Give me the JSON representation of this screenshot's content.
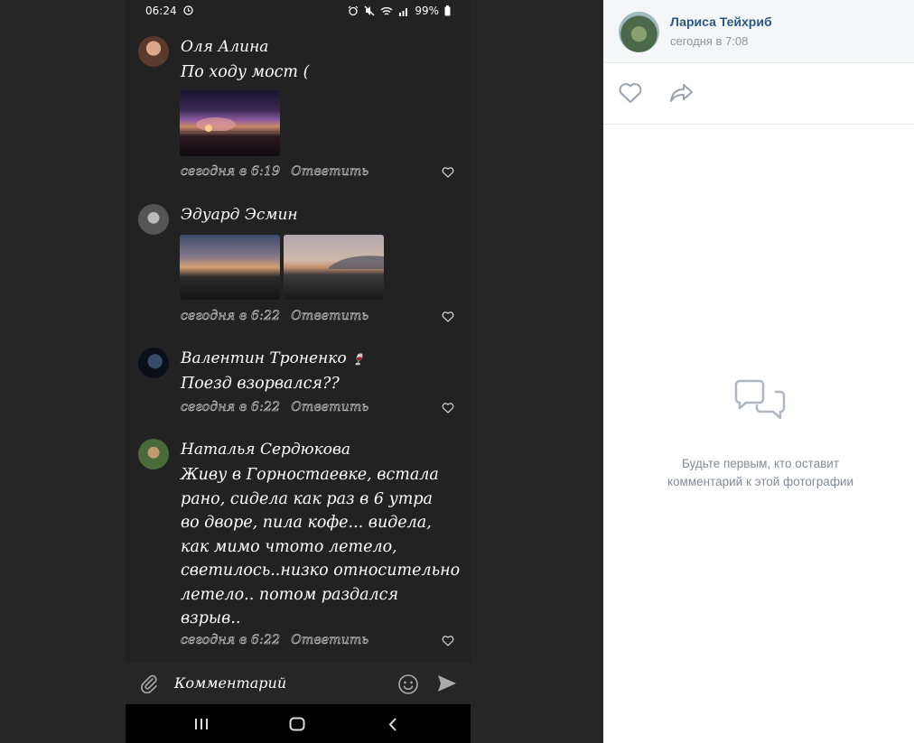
{
  "status_bar": {
    "time": "06:24",
    "battery": "99%"
  },
  "comments": [
    {
      "author": "Оля Алина",
      "text": "По ходу мост (",
      "time": "сегодня в 6:19",
      "reply": "Ответить"
    },
    {
      "author": "Эдуард Эсмин",
      "text": "",
      "time": "сегодня в 6:22",
      "reply": "Ответить"
    },
    {
      "author": "Валентин Троненко",
      "author_emoji": "🍷",
      "text": "Поезд взорвался??",
      "time": "сегодня в 6:22",
      "reply": "Ответить"
    },
    {
      "author": "Наталья Сердюкова",
      "text_lines": [
        "Живу в Горностаевке, встала",
        "рано, сидела как раз в 6 утра",
        "во дворе, пила кофе... видела,",
        "как мимо чтото летело,",
        "светилось..низко относительно",
        "летело.. потом раздался",
        "взрыв.."
      ],
      "time": "сегодня в 6:22",
      "reply": "Ответить"
    }
  ],
  "input": {
    "placeholder": "Комментарий"
  },
  "post": {
    "author": "Лариса Тейхриб",
    "time": "сегодня в 7:08",
    "empty_text_line1": "Будьте первым, кто оставит",
    "empty_text_line2": "комментарий к этой фотографии"
  },
  "colors": {
    "link": "#2a5885",
    "muted": "#818c99",
    "phone_bg": "#222222"
  },
  "icons": [
    "alarm-icon",
    "mute-icon",
    "wifi-icon",
    "signal-icon",
    "battery-icon",
    "heart-icon",
    "paperclip-icon",
    "emoji-icon",
    "send-icon",
    "recents-icon",
    "home-icon",
    "back-icon",
    "like-icon",
    "share-icon",
    "comments-icon"
  ]
}
